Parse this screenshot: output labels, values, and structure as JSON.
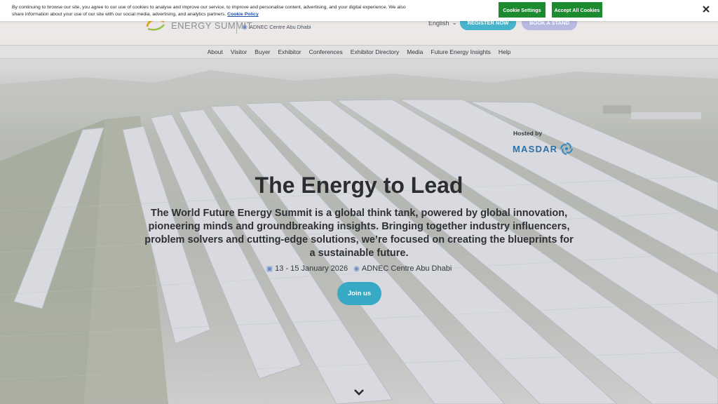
{
  "cookie_banner": {
    "text": "By continuing to browse our site, you agree to our use of cookies to analyse and improve our service, to improve and personalise content, advertising, and your digital experience. We also share information about your use of our site with our social media, advertising, and analytics partners.",
    "policy_link": "Cookie Policy",
    "settings_label": "Cookie Settings",
    "accept_label": "Accept All Cookies",
    "close_icon": "close-icon"
  },
  "header": {
    "logo_text": "ENERGY SUMMIT",
    "venue": "ADNEC Centre Abu Dhabi",
    "language": "English",
    "register_label": "REGISTER NOW",
    "book_label": "BOOK A STAND"
  },
  "nav": {
    "items": [
      {
        "label": "About"
      },
      {
        "label": "Visitor"
      },
      {
        "label": "Buyer"
      },
      {
        "label": "Exhibitor"
      },
      {
        "label": "Conferences"
      },
      {
        "label": "Exhibitor Directory"
      },
      {
        "label": "Media"
      },
      {
        "label": "Future Energy Insights"
      },
      {
        "label": "Help"
      }
    ]
  },
  "hero": {
    "hosted_label": "Hosted by",
    "host_name": "MASDAR",
    "title": "The Energy to Lead",
    "description": "The World Future Energy Summit is a global think tank, powered by global innovation, pioneering minds and groundbreaking insights. Bringing together industry influencers, problem solvers and cutting-edge solutions, we’re focused on creating the blueprints for a sustainable future.",
    "dates": "13 - 15 January 2026",
    "location": "ADNEC Centre Abu Dhabi",
    "join_label": "Join us"
  },
  "colors": {
    "accent_teal": "#37a9c5",
    "cookie_green": "#1c8a2e",
    "book_lavender": "#b7b9e0",
    "masdar_blue": "#2f6fa6"
  }
}
